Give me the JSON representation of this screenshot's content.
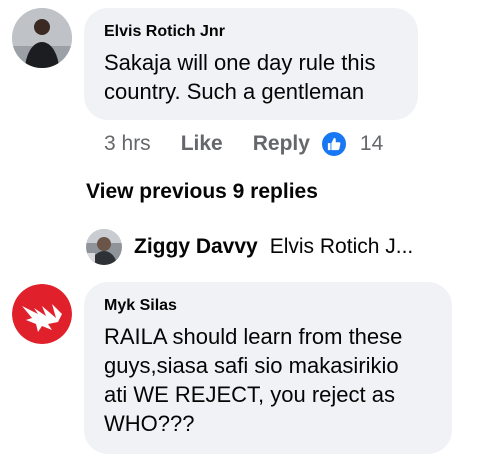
{
  "comments": [
    {
      "author": "Elvis Rotich Jnr",
      "text_lines": [
        "Sakaja will one day rule this",
        "country. Such a gentleman"
      ],
      "time": "3 hrs",
      "like_label": "Like",
      "reply_label": "Reply",
      "reaction_icon": "thumbs-up-icon",
      "reaction_count": "14"
    },
    {
      "author": "Myk Silas",
      "text_lines": [
        "RAILA should learn from these",
        "guys,siasa safi sio makasirikio",
        "ati WE REJECT, you reject as",
        "WHO???"
      ]
    }
  ],
  "view_previous_label": "View previous 9 replies",
  "reply_preview": {
    "author": "Ziggy Davvy",
    "snippet": "Elvis Rotich J..."
  },
  "colors": {
    "bubble": "#f0f2f5",
    "meta_text": "#65676b",
    "reaction_blue": "#1877f2",
    "avatar2_red": "#e0202a"
  }
}
